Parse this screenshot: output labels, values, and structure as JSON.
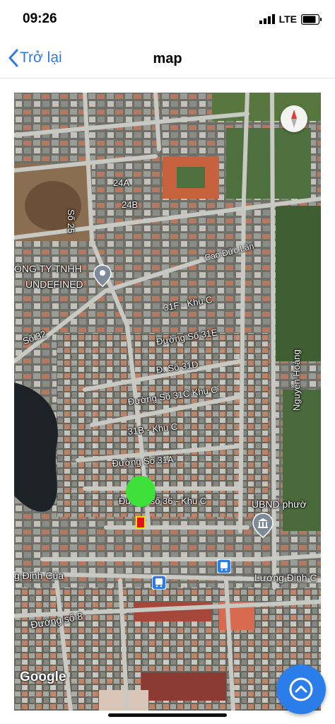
{
  "status": {
    "time": "09:26",
    "network": "LTE"
  },
  "nav": {
    "back_label": "Trở lại",
    "title": "map"
  },
  "map": {
    "labels": {
      "l24a": "24A",
      "l24b": "24B",
      "so25": "Số 25",
      "company": "ÔNG TY TNHH",
      "undefined": "UNDEFINED",
      "cao_duc_lan": "Cao Đức Lân",
      "l31f": "31F - Khu C",
      "duong31e": "Đường Số 31E",
      "d31d": "Đ. Số 31D",
      "duong31c": "Đường Số 31C Khu C",
      "so32": "Số 32",
      "l31b": "31B - Khu C",
      "duong31a": "Đường Số 31A",
      "duong36": "Đường số 36 - Khu C",
      "ubnd": "UBND phườ",
      "nguyen_hoang": "Nguyễn Hoàng",
      "dinh_cua": "g Định Của",
      "luong_dinh": "Lương Định C",
      "duong8": "Đường số 8"
    },
    "attribution": "Google",
    "colors": {
      "road": "#c9c9c4",
      "marker": "#3ee03a",
      "accent": "#2b7de9",
      "plot": "#e3121a"
    }
  }
}
